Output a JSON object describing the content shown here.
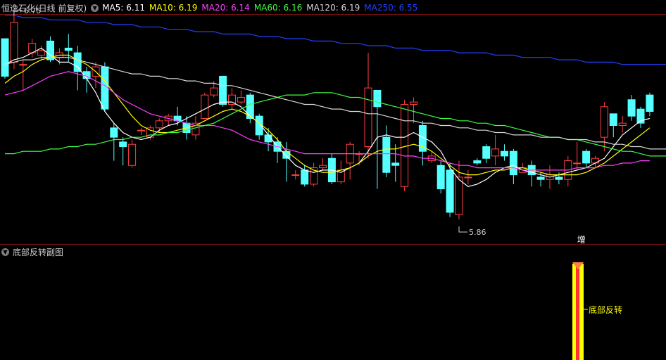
{
  "header": {
    "stock_title": "恒逸石化(日线 前复权)",
    "ma": [
      {
        "label": "MA5: 6.11",
        "color": "#ffffff"
      },
      {
        "label": "MA10: 6.19",
        "color": "#ffff00"
      },
      {
        "label": "MA20: 6.14",
        "color": "#ff40ff"
      },
      {
        "label": "MA60: 6.16",
        "color": "#40ff40"
      },
      {
        "label": "MA120: 6.19",
        "color": "#d8d8d8"
      },
      {
        "label": "MA250: 6.55",
        "color": "#2040ff"
      }
    ]
  },
  "annotations": {
    "high_label": "6.75",
    "low_label": "5.86",
    "signal_mark": "增"
  },
  "sub_panel": {
    "title": "底部反转副图",
    "signal_label": "底部反转"
  },
  "colors": {
    "up": "#ff4040",
    "down": "#54ffff",
    "grid": "#7a1010",
    "signal": "#ffff00"
  },
  "icons": {
    "collapse_main": "chevron-down-circle-icon",
    "collapse_sub": "chevron-down-circle-icon"
  },
  "chart_data": {
    "type": "candlestick",
    "ylim": [
      5.8,
      6.8
    ],
    "candles": [
      [
        6.66,
        6.5,
        6.66,
        6.49
      ],
      [
        6.56,
        6.73,
        6.76,
        6.53
      ],
      [
        6.55,
        6.55,
        6.57,
        6.44
      ],
      [
        6.6,
        6.64,
        6.66,
        6.58
      ],
      [
        6.59,
        6.61,
        6.63,
        6.57
      ],
      [
        6.65,
        6.57,
        6.67,
        6.56
      ],
      [
        6.58,
        6.6,
        6.62,
        6.55
      ],
      [
        6.62,
        6.61,
        6.68,
        6.56
      ],
      [
        6.6,
        6.52,
        6.63,
        6.44
      ],
      [
        6.52,
        6.49,
        6.54,
        6.43
      ],
      [
        6.5,
        6.54,
        6.56,
        6.45
      ],
      [
        6.54,
        6.36,
        6.56,
        6.35
      ],
      [
        6.28,
        6.24,
        6.3,
        6.14
      ],
      [
        6.22,
        6.2,
        6.24,
        6.12
      ],
      [
        6.12,
        6.21,
        6.23,
        6.11
      ],
      [
        6.27,
        6.27,
        6.28,
        6.25
      ],
      [
        6.24,
        6.28,
        6.29,
        6.23
      ],
      [
        6.28,
        6.31,
        6.32,
        6.26
      ],
      [
        6.31,
        6.33,
        6.34,
        6.29
      ],
      [
        6.33,
        6.31,
        6.37,
        6.29
      ],
      [
        6.3,
        6.26,
        6.33,
        6.23
      ],
      [
        6.25,
        6.3,
        6.33,
        6.23
      ],
      [
        6.32,
        6.42,
        6.43,
        6.33
      ],
      [
        6.42,
        6.45,
        6.48,
        6.41
      ],
      [
        6.5,
        6.38,
        6.5,
        6.37
      ],
      [
        6.38,
        6.42,
        6.45,
        6.36
      ],
      [
        6.39,
        6.41,
        6.44,
        6.38
      ],
      [
        6.42,
        6.32,
        6.43,
        6.3
      ],
      [
        6.33,
        6.25,
        6.34,
        6.23
      ],
      [
        6.25,
        6.22,
        6.28,
        6.18
      ],
      [
        6.22,
        6.18,
        6.24,
        6.13
      ],
      [
        6.18,
        6.15,
        6.22,
        6.05
      ],
      [
        6.08,
        6.08,
        6.1,
        6.06
      ],
      [
        6.1,
        6.04,
        6.12,
        6.03
      ],
      [
        6.04,
        6.11,
        6.13,
        6.03
      ],
      [
        6.11,
        6.12,
        6.15,
        6.1
      ],
      [
        6.15,
        6.05,
        6.17,
        6.04
      ],
      [
        6.05,
        6.1,
        6.14,
        6.04
      ],
      [
        6.13,
        6.21,
        6.22,
        6.06
      ],
      [
        6.17,
        6.17,
        6.18,
        6.12
      ],
      [
        6.2,
        6.45,
        6.6,
        6.15
      ],
      [
        6.44,
        6.37,
        6.42,
        6.02
      ],
      [
        6.24,
        6.09,
        6.29,
        6.07
      ],
      [
        6.13,
        6.12,
        6.21,
        6.05
      ],
      [
        6.03,
        6.38,
        6.4,
        6.01
      ],
      [
        6.38,
        6.39,
        6.41,
        6.3
      ],
      [
        6.29,
        6.18,
        6.31,
        6.12
      ],
      [
        6.14,
        6.16,
        6.18,
        6.13
      ],
      [
        6.12,
        6.02,
        6.14,
        6.0
      ],
      [
        6.1,
        5.92,
        6.13,
        5.9
      ],
      [
        5.91,
        6.07,
        6.14,
        5.89
      ],
      [
        6.07,
        6.07,
        6.1,
        6.04
      ],
      [
        6.14,
        6.13,
        6.15,
        6.12
      ],
      [
        6.2,
        6.15,
        6.21,
        6.13
      ],
      [
        6.16,
        6.19,
        6.25,
        6.12
      ],
      [
        6.18,
        6.16,
        6.21,
        6.14
      ],
      [
        6.18,
        6.08,
        6.19,
        6.04
      ],
      [
        6.09,
        6.11,
        6.13,
        6.09
      ],
      [
        6.12,
        6.08,
        6.14,
        6.03
      ],
      [
        6.07,
        6.06,
        6.09,
        6.03
      ],
      [
        6.06,
        6.08,
        6.12,
        6.02
      ],
      [
        6.07,
        6.06,
        6.09,
        6.04
      ],
      [
        6.06,
        6.14,
        6.16,
        6.03
      ],
      [
        6.13,
        6.13,
        6.22,
        6.1
      ],
      [
        6.18,
        6.13,
        6.19,
        6.11
      ],
      [
        6.13,
        6.15,
        6.16,
        6.11
      ],
      [
        6.24,
        6.37,
        6.39,
        6.18
      ],
      [
        6.34,
        6.29,
        6.31,
        6.24
      ],
      [
        6.29,
        6.3,
        6.33,
        6.26
      ],
      [
        6.4,
        6.33,
        6.42,
        6.31
      ],
      [
        6.36,
        6.3,
        6.37,
        6.28
      ],
      [
        6.42,
        6.35,
        6.43,
        6.33
      ]
    ],
    "series": [
      {
        "name": "MA5",
        "color": "#ffffff",
        "values": [
          6.55,
          6.57,
          6.58,
          6.6,
          6.62,
          6.59,
          6.56,
          6.56,
          6.54,
          6.49,
          6.43,
          6.35,
          6.3,
          6.26,
          6.24,
          6.23,
          6.24,
          6.27,
          6.29,
          6.3,
          6.32,
          6.34,
          6.36,
          6.38,
          6.39,
          6.39,
          6.37,
          6.33,
          6.3,
          6.25,
          6.2,
          6.16,
          6.12,
          6.1,
          6.09,
          6.1,
          6.1,
          6.09,
          6.11,
          6.13,
          6.18,
          6.24,
          6.25,
          6.24,
          6.24,
          6.26,
          6.24,
          6.22,
          6.18,
          6.11,
          6.06,
          6.03,
          6.04,
          6.06,
          6.09,
          6.11,
          6.12,
          6.1,
          6.09,
          6.08,
          6.07,
          6.08,
          6.09,
          6.1,
          6.11,
          6.13,
          6.15,
          6.2,
          6.25,
          6.28,
          6.31,
          6.32
        ]
      },
      {
        "name": "MA10",
        "color": "#ffff00",
        "values": [
          6.47,
          6.5,
          6.52,
          6.55,
          6.57,
          6.58,
          6.59,
          6.59,
          6.57,
          6.55,
          6.52,
          6.48,
          6.43,
          6.38,
          6.33,
          6.29,
          6.27,
          6.26,
          6.26,
          6.27,
          6.28,
          6.29,
          6.31,
          6.33,
          6.35,
          6.36,
          6.35,
          6.33,
          6.3,
          6.27,
          6.23,
          6.18,
          6.15,
          6.12,
          6.1,
          6.09,
          6.09,
          6.1,
          6.11,
          6.13,
          6.16,
          6.18,
          6.19,
          6.19,
          6.2,
          6.21,
          6.2,
          6.18,
          6.15,
          6.12,
          6.09,
          6.08,
          6.08,
          6.09,
          6.1,
          6.1,
          6.11,
          6.11,
          6.1,
          6.09,
          6.08,
          6.08,
          6.08,
          6.08,
          6.09,
          6.11,
          6.13,
          6.16,
          6.19,
          6.22,
          6.25,
          6.28
        ]
      },
      {
        "name": "MA20",
        "color": "#ff40ff",
        "values": [
          6.42,
          6.43,
          6.44,
          6.46,
          6.48,
          6.5,
          6.51,
          6.52,
          6.51,
          6.5,
          6.48,
          6.46,
          6.43,
          6.4,
          6.38,
          6.36,
          6.34,
          6.33,
          6.32,
          6.31,
          6.3,
          6.29,
          6.29,
          6.29,
          6.28,
          6.27,
          6.25,
          6.23,
          6.22,
          6.21,
          6.2,
          6.19,
          6.18,
          6.17,
          6.17,
          6.17,
          6.17,
          6.17,
          6.17,
          6.17,
          6.17,
          6.17,
          6.17,
          6.17,
          6.16,
          6.16,
          6.15,
          6.15,
          6.14,
          6.13,
          6.12,
          6.12,
          6.11,
          6.11,
          6.11,
          6.11,
          6.11,
          6.1,
          6.1,
          6.1,
          6.1,
          6.1,
          6.1,
          6.11,
          6.11,
          6.11,
          6.12,
          6.12,
          6.13,
          6.13,
          6.14,
          6.14
        ]
      },
      {
        "name": "MA60",
        "color": "#40ff40",
        "values": [
          6.17,
          6.17,
          6.18,
          6.18,
          6.18,
          6.19,
          6.19,
          6.2,
          6.2,
          6.21,
          6.21,
          6.22,
          6.23,
          6.23,
          6.24,
          6.24,
          6.25,
          6.25,
          6.26,
          6.26,
          6.27,
          6.28,
          6.29,
          6.3,
          6.32,
          6.34,
          6.36,
          6.38,
          6.39,
          6.4,
          6.41,
          6.42,
          6.42,
          6.42,
          6.43,
          6.43,
          6.43,
          6.42,
          6.41,
          6.41,
          6.4,
          6.39,
          6.38,
          6.37,
          6.36,
          6.35,
          6.34,
          6.33,
          6.32,
          6.32,
          6.31,
          6.31,
          6.3,
          6.3,
          6.29,
          6.29,
          6.28,
          6.27,
          6.26,
          6.25,
          6.24,
          6.24,
          6.23,
          6.23,
          6.22,
          6.21,
          6.2,
          6.19,
          6.18,
          6.18,
          6.17,
          6.16
        ]
      },
      {
        "name": "MA120",
        "color": "#d8d8d8",
        "values": [
          6.55,
          6.56,
          6.57,
          6.57,
          6.58,
          6.58,
          6.58,
          6.58,
          6.57,
          6.56,
          6.55,
          6.54,
          6.53,
          6.52,
          6.51,
          6.51,
          6.5,
          6.5,
          6.49,
          6.49,
          6.48,
          6.48,
          6.47,
          6.47,
          6.46,
          6.46,
          6.45,
          6.44,
          6.43,
          6.42,
          6.41,
          6.4,
          6.39,
          6.38,
          6.38,
          6.37,
          6.36,
          6.36,
          6.35,
          6.35,
          6.34,
          6.34,
          6.33,
          6.32,
          6.31,
          6.31,
          6.3,
          6.3,
          6.29,
          6.29,
          6.28,
          6.28,
          6.27,
          6.27,
          6.26,
          6.26,
          6.25,
          6.25,
          6.25,
          6.24,
          6.24,
          6.24,
          6.23,
          6.23,
          6.23,
          6.22,
          6.22,
          6.21,
          6.21,
          6.2,
          6.2,
          6.19
        ]
      },
      {
        "name": "MA250",
        "color": "#2040ff",
        "values": [
          6.76,
          6.76,
          6.75,
          6.75,
          6.75,
          6.74,
          6.74,
          6.74,
          6.74,
          6.73,
          6.73,
          6.73,
          6.72,
          6.72,
          6.72,
          6.71,
          6.71,
          6.71,
          6.7,
          6.7,
          6.7,
          6.69,
          6.69,
          6.69,
          6.68,
          6.68,
          6.68,
          6.68,
          6.67,
          6.67,
          6.67,
          6.66,
          6.66,
          6.66,
          6.65,
          6.65,
          6.65,
          6.64,
          6.64,
          6.64,
          6.63,
          6.63,
          6.63,
          6.62,
          6.62,
          6.62,
          6.61,
          6.61,
          6.61,
          6.61,
          6.6,
          6.6,
          6.6,
          6.6,
          6.59,
          6.59,
          6.59,
          6.58,
          6.58,
          6.58,
          6.58,
          6.57,
          6.57,
          6.57,
          6.56,
          6.56,
          6.56,
          6.56,
          6.55,
          6.55,
          6.55,
          6.55
        ]
      }
    ],
    "high": {
      "index": 1,
      "value": 6.75
    },
    "low": {
      "index": 50,
      "value": 5.86
    },
    "signal_index": 63
  }
}
